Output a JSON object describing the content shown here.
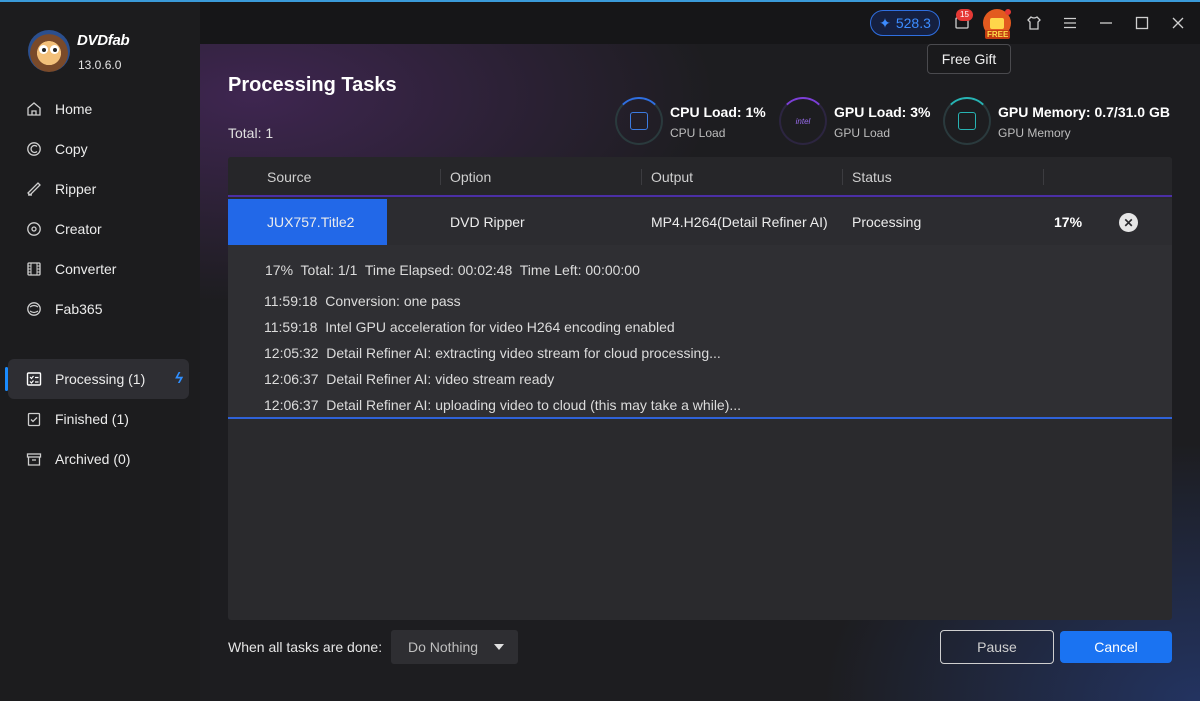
{
  "app": {
    "brand": "DVDfab",
    "version": "13.0.6.0"
  },
  "sidebar": {
    "items": [
      {
        "label": "Home",
        "icon": "home-icon"
      },
      {
        "label": "Copy",
        "icon": "copy-icon"
      },
      {
        "label": "Ripper",
        "icon": "ripper-icon"
      },
      {
        "label": "Creator",
        "icon": "creator-icon"
      },
      {
        "label": "Converter",
        "icon": "converter-icon"
      },
      {
        "label": "Fab365",
        "icon": "fab365-icon"
      }
    ],
    "queue": [
      {
        "label": "Processing (1)",
        "icon": "processing-icon",
        "active": true
      },
      {
        "label": "Finished (1)",
        "icon": "finished-icon"
      },
      {
        "label": "Archived (0)",
        "icon": "archived-icon"
      }
    ]
  },
  "topbar": {
    "credits": "528.3",
    "notifications_count": "15",
    "gift_badge": "FREE",
    "tooltip": "Free Gift"
  },
  "page": {
    "title": "Processing Tasks",
    "total": "Total: 1"
  },
  "meters": {
    "cpu": {
      "title": "CPU Load: 1%",
      "sub": "CPU Load"
    },
    "gpu": {
      "title": "GPU Load: 3%",
      "sub": "GPU Load",
      "chip_label": "intel"
    },
    "memory": {
      "title": "GPU Memory: 0.7/31.0 GB",
      "sub": "GPU Memory"
    }
  },
  "table": {
    "headers": [
      "Source",
      "Option",
      "Output",
      "Status"
    ],
    "row": {
      "source": "JUX757.Title2",
      "option": "DVD Ripper",
      "output": "MP4.H264(Detail Refiner AI)",
      "status": "Processing",
      "percent": "17%"
    },
    "summary": "17%  Total: 1/1  Time Elapsed: 00:02:48  Time Left: 00:00:00",
    "log": [
      "11:59:18  Conversion: one pass",
      "11:59:18  Intel GPU acceleration for video H264 encoding enabled",
      "12:05:32  Detail Refiner AI: extracting video stream for cloud processing...",
      "12:06:37  Detail Refiner AI: video stream ready",
      "12:06:37  Detail Refiner AI: uploading video to cloud (this may take a while)..."
    ]
  },
  "footer": {
    "when_label": "When all tasks are done:",
    "when_value": "Do Nothing",
    "pause": "Pause",
    "cancel": "Cancel"
  },
  "colors": {
    "accent": "#1a73f2",
    "selected_row": "#2268e8",
    "header_underline": "#4b2fa5"
  }
}
